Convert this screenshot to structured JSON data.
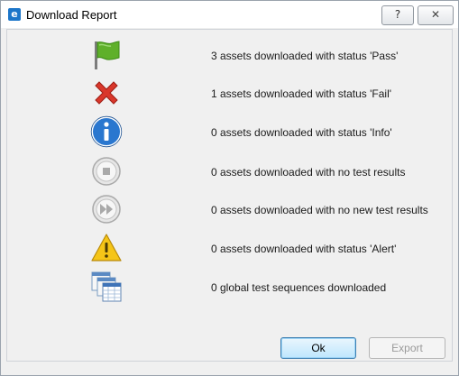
{
  "window": {
    "title": "Download Report",
    "help_glyph": "?",
    "close_glyph": "✕"
  },
  "rows": [
    {
      "icon": "green-flag-icon",
      "message": "3 assets downloaded with status 'Pass'"
    },
    {
      "icon": "red-x-icon",
      "message": "1 assets downloaded with status 'Fail'"
    },
    {
      "icon": "info-icon",
      "message": "0 assets downloaded with status 'Info'"
    },
    {
      "icon": "stop-icon",
      "message": "0 assets downloaded with no test results"
    },
    {
      "icon": "fast-forward-icon",
      "message": "0 assets downloaded with no new test results"
    },
    {
      "icon": "alert-triangle-icon",
      "message": "0 assets downloaded with status 'Alert'"
    },
    {
      "icon": "test-sequences-icon",
      "message": "0 global test sequences downloaded"
    }
  ],
  "buttons": {
    "ok_label": "Ok",
    "export_label": "Export"
  },
  "colors": {
    "pass": "#5fb02a",
    "fail": "#d9372b",
    "info": "#2a77cf",
    "disabled_gray": "#a9a9a9",
    "alert": "#f5c518",
    "ok_border": "#3c7fb1"
  }
}
